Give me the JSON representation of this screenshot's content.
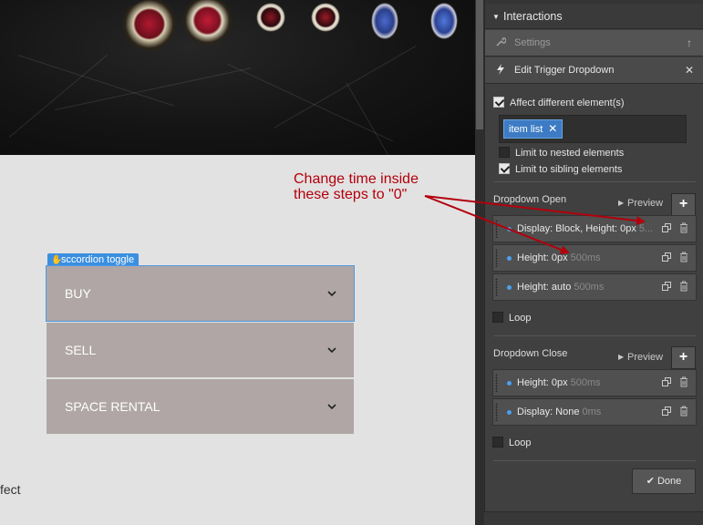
{
  "canvas": {
    "element_label": "sccordion toggle",
    "accordion_items": [
      {
        "label": "BUY"
      },
      {
        "label": "SELL"
      },
      {
        "label": "SPACE RENTAL"
      }
    ],
    "partial_text": "fect"
  },
  "annotation": {
    "line1": "Change time inside",
    "line2": "these steps to \"0\"",
    "color": "#b3000b"
  },
  "panel": {
    "title": "Interactions",
    "settings_label": "Settings",
    "trigger_label": "Edit Trigger Dropdown",
    "affect_label": "Affect different element(s)",
    "affect_checked": true,
    "selector_token": "item list",
    "nested_label": "Limit to nested elements",
    "nested_checked": false,
    "sibling_label": "Limit to sibling elements",
    "sibling_checked": true,
    "open": {
      "label": "Dropdown Open",
      "preview_label": "Preview",
      "steps": [
        {
          "label": "Display: Block, Height: 0px",
          "duration": "5..."
        },
        {
          "label": "Height: 0px",
          "duration": "500ms"
        },
        {
          "label": "Height: auto",
          "duration": "500ms"
        }
      ],
      "loop_label": "Loop",
      "loop_checked": false
    },
    "close": {
      "label": "Dropdown Close",
      "preview_label": "Preview",
      "steps": [
        {
          "label": "Height: 0px",
          "duration": "500ms"
        },
        {
          "label": "Display: None",
          "duration": "0ms"
        }
      ],
      "loop_label": "Loop",
      "loop_checked": false
    },
    "done_label": "Done",
    "accent": "#3d7cc4"
  }
}
